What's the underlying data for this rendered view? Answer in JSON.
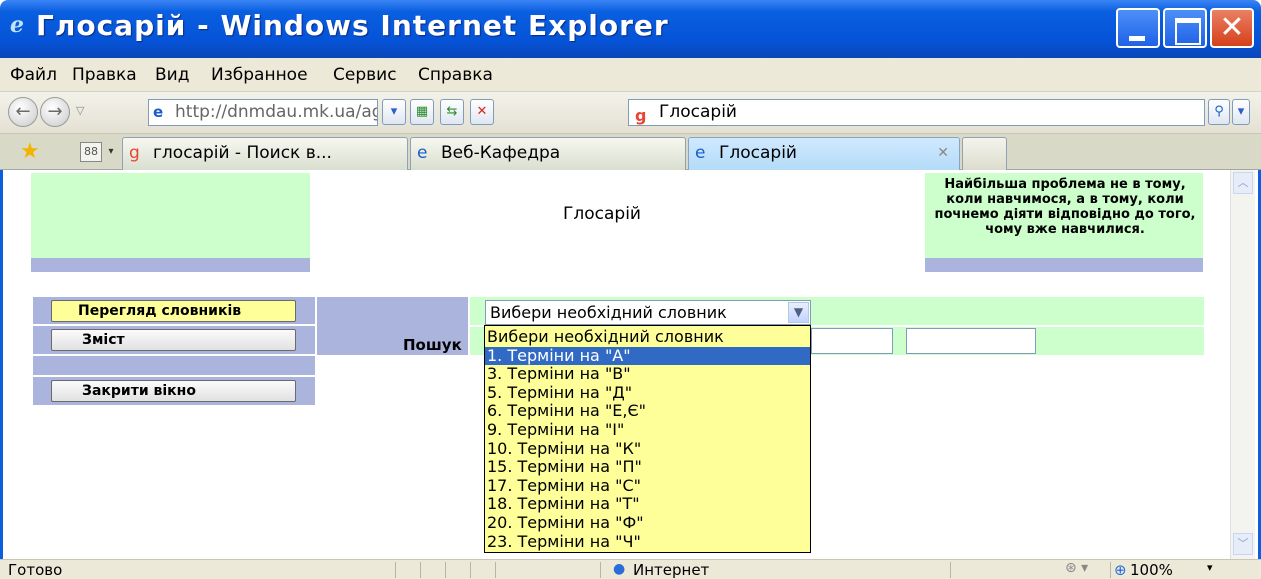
{
  "window": {
    "title": "Глосарій - Windows Internet Explorer"
  },
  "menu": [
    "Файл",
    "Правка",
    "Вид",
    "Избранное",
    "Сервис",
    "Справка"
  ],
  "address": {
    "url": "http://dnmdau.mk.ua/agr"
  },
  "search": {
    "value": "Глосарій"
  },
  "tabs": [
    {
      "label": "глосарій - Поиск в..."
    },
    {
      "label": "Веб-Кафедра"
    },
    {
      "label": "Глосарій"
    }
  ],
  "page": {
    "heading": "Глосарій",
    "quote": "Найбільша проблема не в тому, коли навчимося, а в тому, коли почнемо діяти відповідно до того, чому вже навчилися.",
    "buttons": {
      "browse": "Перегляд словників",
      "contents": "Зміст",
      "close": "Закрити вікно"
    },
    "search_label": "Пошук",
    "select_value": "Вибери необхідний словник",
    "options": [
      "Вибери необхідний словник",
      "1. Терміни на \"А\"",
      "3. Терміни на \"В\"",
      "5. Терміни на \"Д\"",
      "6. Терміни на \"Е,Є\"",
      "9. Терміни на \"І\"",
      "10. Терміни на \"К\"",
      "15. Терміни на \"П\"",
      "17. Терміни на \"С\"",
      "18. Терміни на \"Т\"",
      "20. Терміни на \"Ф\"",
      "23. Терміни на \"Ч\""
    ],
    "selected_option": 1
  },
  "status": {
    "text": "Готово",
    "zone": "Интернет",
    "zoom": "100%"
  },
  "colors": {
    "titlebar": "#0553d8",
    "green_panel": "#ccffcc",
    "blue_strip": "#aab4dd",
    "dropdown_bg": "#ffff99",
    "selection": "#316ac5"
  }
}
